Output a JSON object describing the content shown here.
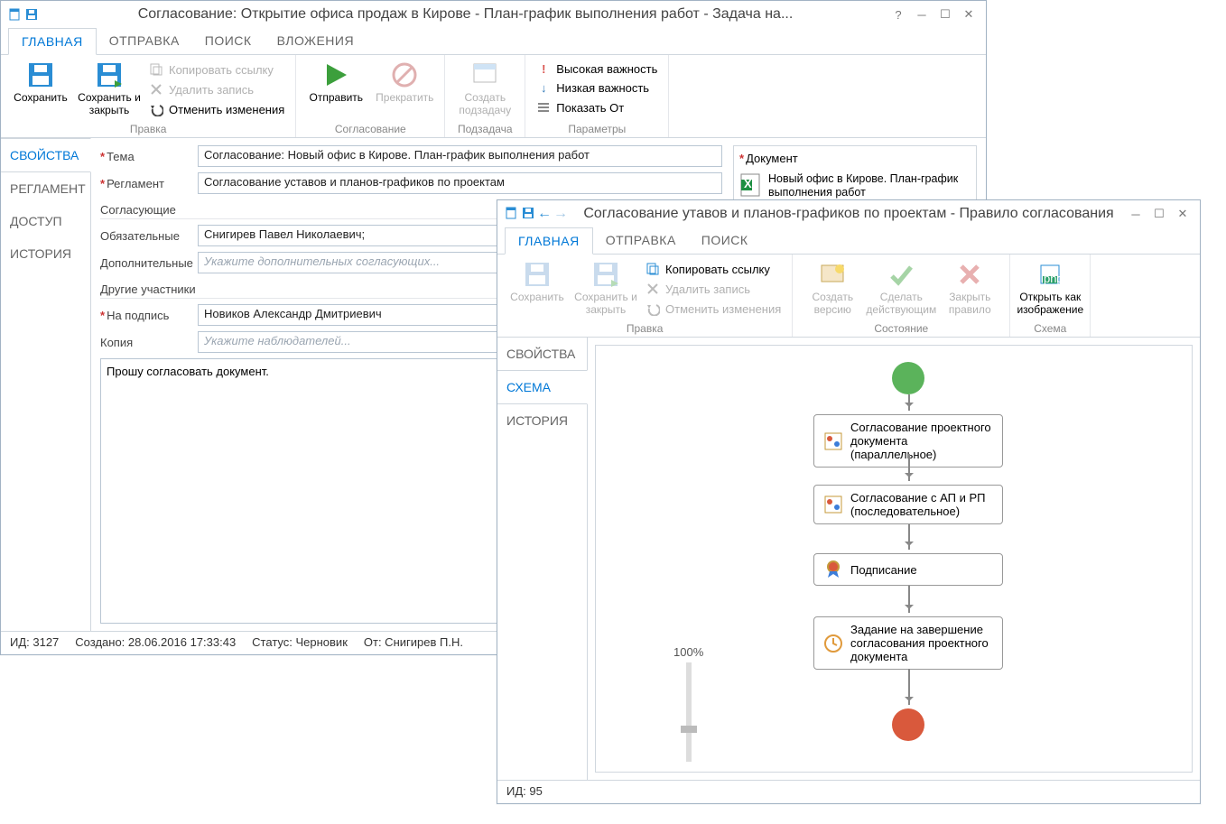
{
  "win1": {
    "title": "Согласование: Открытие офиса продаж в Кирове - План-график выполнения работ - Задача на...",
    "ribbon_tabs": [
      "ГЛАВНАЯ",
      "ОТПРАВКА",
      "ПОИСК",
      "ВЛОЖЕНИЯ"
    ],
    "ribbon": {
      "save": "Сохранить",
      "save_close": "Сохранить и закрыть",
      "edit_group": "Правка",
      "copy_link": "Копировать ссылку",
      "delete": "Удалить запись",
      "undo": "Отменить изменения",
      "send": "Отправить",
      "stop": "Прекратить",
      "approval_group": "Согласование",
      "create_sub": "Создать подзадачу",
      "subtask_group": "Подзадача",
      "high": "Высокая важность",
      "low": "Низкая важность",
      "show_from": "Показать От",
      "params_group": "Параметры"
    },
    "side_tabs": [
      "СВОЙСТВА",
      "РЕГЛАМЕНТ",
      "ДОСТУП",
      "ИСТОРИЯ"
    ],
    "form": {
      "subject_label": "Тема",
      "subject_value": "Согласование: Новый офис в Кирове. План-график выполнения работ",
      "reglament_label": "Регламент",
      "reglament_value": "Согласование уставов и планов-графиков по проектам",
      "approvers_h": "Согласующие",
      "required_label": "Обязательные",
      "required_value": "Снигирев Павел Николаевич;",
      "optional_label": "Дополнительные",
      "optional_ph": "Укажите дополнительных согласующих...",
      "others_h": "Другие участники",
      "sign_label": "На подпись",
      "sign_value": "Новиков Александр Дмитриевич",
      "copy_label": "Копия",
      "copy_ph": "Укажите наблюдателей...",
      "body_text": "Прошу согласовать документ."
    },
    "docs": {
      "title": "Документ",
      "item1": "Новый офис в Кирове. План-график выполнения работ"
    },
    "status": {
      "id": "ИД: 3127",
      "created": "Создано: 28.06.2016 17:33:43",
      "status": "Статус: Черновик",
      "from": "От: Снигирев П.Н."
    }
  },
  "win2": {
    "title": "Согласование утавов и планов-графиков по проектам - Правило согласования",
    "ribbon_tabs": [
      "ГЛАВНАЯ",
      "ОТПРАВКА",
      "ПОИСК"
    ],
    "ribbon": {
      "save": "Сохранить",
      "save_close": "Сохранить и закрыть",
      "edit_group": "Правка",
      "copy_link": "Копировать ссылку",
      "delete": "Удалить запись",
      "undo": "Отменить изменения",
      "create_ver": "Создать версию",
      "make_active": "Сделать действующим",
      "close_rule": "Закрыть правило",
      "state_group": "Состояние",
      "open_img": "Открыть как изображение",
      "scheme_group": "Схема"
    },
    "side_tabs": [
      "СВОЙСТВА",
      "СХЕМА",
      "ИСТОРИЯ"
    ],
    "nodes": {
      "n1": "Согласование проектного документа (параллельное)",
      "n2": "Согласование с АП и РП (последовательное)",
      "n3": "Подписание",
      "n4": "Задание на завершение согласования проектного документа"
    },
    "zoom": "100%",
    "status_id": "ИД: 95"
  }
}
